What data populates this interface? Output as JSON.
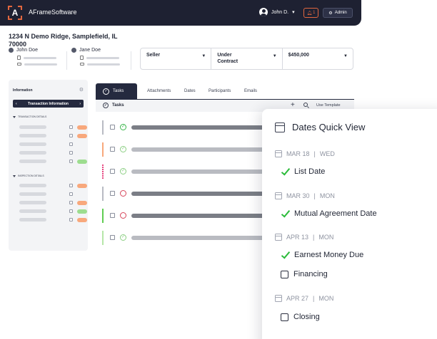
{
  "app": {
    "name": "AFrameSoftware",
    "logo_letter": "A"
  },
  "topbar": {
    "user_name": "John D.",
    "notification_count": "1",
    "admin_label": "Admin"
  },
  "property": {
    "address": "1234 N Demo Ridge, Samplefield, IL 70000",
    "parties": [
      {
        "name": "John Doe"
      },
      {
        "name": "Jane Doe"
      }
    ]
  },
  "summary": {
    "role": "Seller",
    "status": "Under Contract",
    "price": "$450,000"
  },
  "info_panel": {
    "title": "Information",
    "selector_label": "Transaction Information",
    "sections": [
      {
        "label": "TRANSACTION DETAILS"
      },
      {
        "label": "INSPECTION DETAILS"
      }
    ],
    "status_colors": {
      "orange": "#f8a87c",
      "green": "#9ddd8f"
    }
  },
  "tabs": [
    {
      "label": "Tasks"
    },
    {
      "label": "Attachments"
    },
    {
      "label": "Dates"
    },
    {
      "label": "Participants"
    },
    {
      "label": "Emails"
    }
  ],
  "tasks_toolbar": {
    "title": "Tasks",
    "template_label": "Use Template"
  },
  "task_row_colors": {
    "edges": [
      "#b8bbc3",
      "#f8a87c",
      "#e6457f",
      "#b8bbc3",
      "#60cd52",
      "#b6e6a8"
    ],
    "dark_bar": "#7b7e86",
    "light_bar": "#b9bbc1"
  },
  "dates_quick_view": {
    "title": "Dates Quick View",
    "groups": [
      {
        "date": "MAR 18",
        "day": "WED",
        "items": [
          {
            "label": "List Date",
            "done": true
          }
        ]
      },
      {
        "date": "MAR 30",
        "day": "MON",
        "items": [
          {
            "label": "Mutual Agreement Date",
            "done": true
          }
        ]
      },
      {
        "date": "APR 13",
        "day": "MON",
        "items": [
          {
            "label": "Earnest Money Due",
            "done": true
          },
          {
            "label": "Financing",
            "done": false
          }
        ]
      },
      {
        "date": "APR 27",
        "day": "MON",
        "items": [
          {
            "label": "Closing",
            "done": false
          }
        ]
      }
    ]
  }
}
